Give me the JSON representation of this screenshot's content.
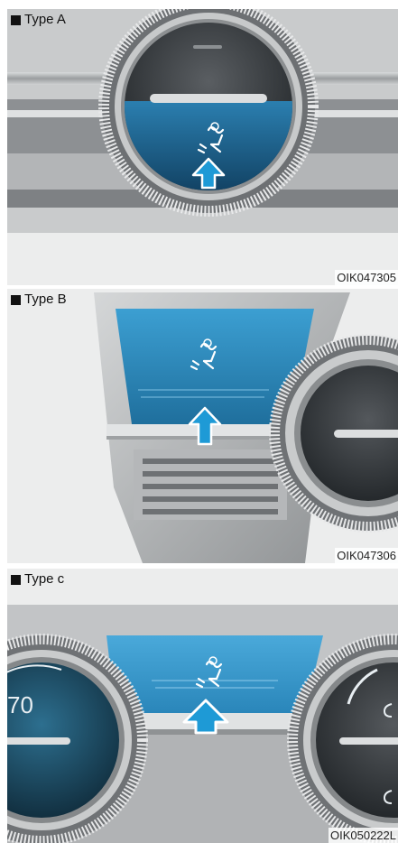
{
  "panels": [
    {
      "label": "Type A",
      "code": "OIK047305"
    },
    {
      "label": "Type B",
      "code": "OIK047306"
    },
    {
      "label": "Type c",
      "code": "OIK050222L"
    }
  ],
  "gauge_text": "70",
  "colors": {
    "display_blue": "#2e8fc2",
    "arrow_blue": "#1e9ad6",
    "chrome": "#b9bcbe"
  }
}
